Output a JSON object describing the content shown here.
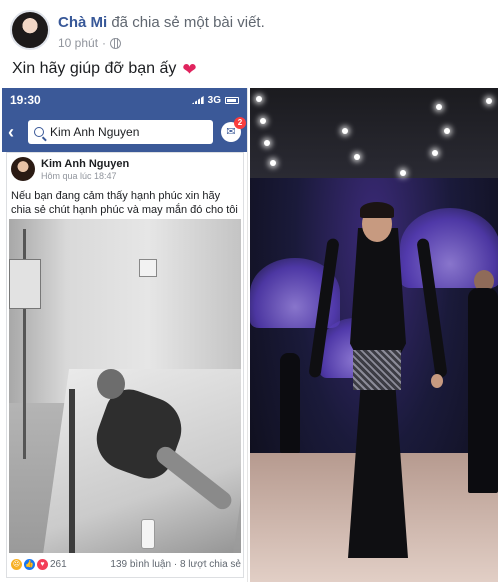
{
  "post": {
    "author_name": "Chà Mi",
    "author_action": "đã chia sẻ một bài viết.",
    "time": "10 phút",
    "caption": "Xin hãy giúp đỡ bạn ấy"
  },
  "phone": {
    "status_time": "19:30",
    "status_network": "3G",
    "search_value": "Kim Anh Nguyen",
    "messenger_badge": "2"
  },
  "shared_post": {
    "author_name": "Kim Anh Nguyen",
    "time": "Hôm qua lúc 18:47",
    "text": "Nếu bạn đang cảm thấy hạnh phúc xin hãy chia sẻ chút hạnh phúc và may mắn đó cho tôi được không?",
    "reaction_count": "261",
    "comments": "139 bình luận",
    "shares": "8 lượt chia sẻ"
  },
  "colors": {
    "facebook_blue": "#3b5998",
    "link_blue": "#385898",
    "heart_red": "#e0245e"
  }
}
